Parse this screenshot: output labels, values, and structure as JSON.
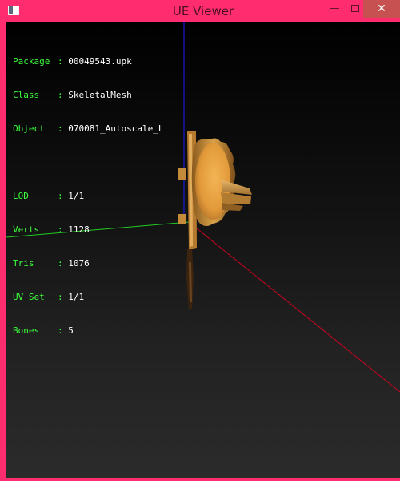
{
  "window": {
    "title": "UE Viewer",
    "accent_color": "#ff2d6f",
    "close_glyph": "✕",
    "minimize_glyph": "—"
  },
  "info": {
    "package": {
      "label": "Package",
      "value": "00049543.upk"
    },
    "class": {
      "label": "Class",
      "value": "SkeletalMesh"
    },
    "object": {
      "label": "Object",
      "value": "070081_Autoscale_L"
    },
    "lod": {
      "label": "LOD",
      "value": "1/1"
    },
    "verts": {
      "label": "Verts",
      "value": "1128"
    },
    "tris": {
      "label": "Tris",
      "value": "1076"
    },
    "uvset": {
      "label": "UV Set",
      "value": "1/1"
    },
    "bones": {
      "label": "Bones",
      "value": "5"
    }
  },
  "colors": {
    "label_text": "#3bff3b",
    "value_text": "#ffffff",
    "axis_x": "#ff0000",
    "axis_y": "#00ff00",
    "axis_z": "#0000ff",
    "mesh": "#e6a040"
  },
  "scene": {
    "mesh_icon": "skeletal-mesh-autoscale"
  }
}
